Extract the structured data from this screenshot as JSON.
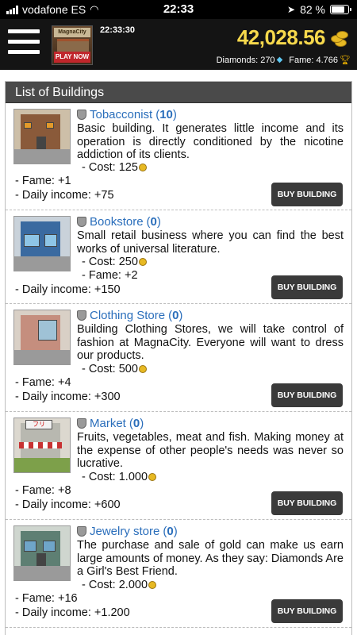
{
  "status_bar": {
    "carrier": "vodafone ES",
    "time": "22:33",
    "battery": "82 %",
    "battery_level": 0.82
  },
  "header": {
    "promo_logo": "MagnaCity",
    "promo_button": "PLAY NOW",
    "clock": "22:33:30",
    "money": "42,028.56",
    "diamonds_label": "Diamonds: 270",
    "fame_label": "Fame: 4.766"
  },
  "panel_title": "List of Buildings",
  "buy_label": "BUY BUILDING",
  "buildings": [
    {
      "name": "Tobacconist",
      "count": "10",
      "description": "Basic building. It generates little income and its operation is directly conditioned by the nicotine addiction of its clients.",
      "cost": "- Cost: 125",
      "fame": "- Fame: +1",
      "income": "- Daily income: +75"
    },
    {
      "name": "Bookstore",
      "count": "0",
      "description": "Small retail business where you can find the best works of universal literature.",
      "cost": "- Cost: 250",
      "fame": "- Fame: +2",
      "income": "- Daily income: +150"
    },
    {
      "name": "Clothing Store",
      "count": "0",
      "description": "Building Clothing Stores, we will take control of fashion at MagnaCity. Everyone will want to dress our products.",
      "cost": "- Cost: 500",
      "fame": "- Fame: +4",
      "income": "- Daily income: +300"
    },
    {
      "name": "Market",
      "count": "0",
      "description": "Fruits, vegetables, meat and fish. Making money at the expense of other people's needs was never so lucrative.",
      "cost": "- Cost: 1.000",
      "fame": "- Fame: +8",
      "income": "- Daily income: +600"
    },
    {
      "name": "Jewelry store",
      "count": "0",
      "description": "The purchase and sale of gold can make us earn large amounts of money. As they say: Diamonds Are a Girl's Best Friend.",
      "cost": "- Cost: 2.000",
      "fame": "- Fame: +16",
      "income": "- Daily income: +1.200"
    }
  ]
}
